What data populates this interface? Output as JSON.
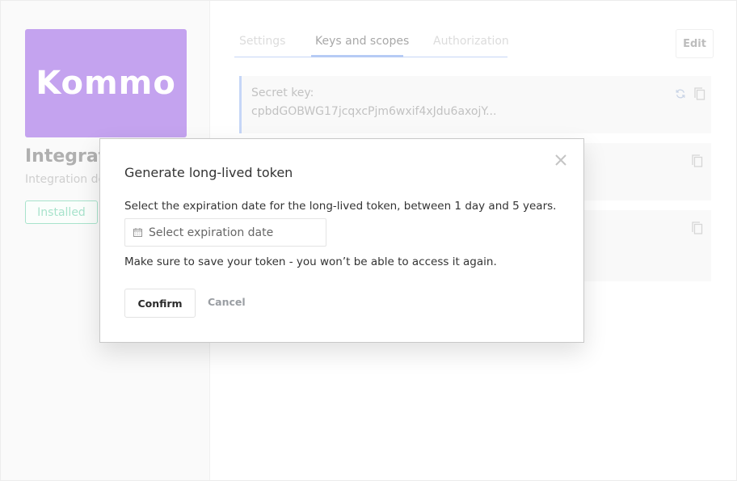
{
  "integration": {
    "logo_text": "Kommo",
    "title": "Integration",
    "description": "Integration description",
    "status_badge": "Installed",
    "brand_color": "#c4a3ef"
  },
  "tabs": [
    {
      "label": "Settings",
      "active": false
    },
    {
      "label": "Keys and scopes",
      "active": true
    },
    {
      "label": "Authorization",
      "active": false
    }
  ],
  "toolbar": {
    "edit_label": "Edit"
  },
  "keys": [
    {
      "label": "Secret key:",
      "value": "cpbdGOBWG17jcqxcPjm6wxif4xJdu6axojY...",
      "icons": [
        "refresh-icon",
        "copy-icon"
      ]
    },
    {
      "label": "",
      "value": "",
      "icons": [
        "copy-icon"
      ]
    },
    {
      "label": "",
      "value": "",
      "icons": [
        "copy-icon"
      ]
    }
  ],
  "modal": {
    "title": "Generate long-lived token",
    "description": "Select the expiration date for the long-lived token, between 1 day and 5 years.",
    "date_input": {
      "placeholder": "Select expiration date",
      "value": ""
    },
    "warning": "Make sure to save your token - you won’t be able to access it again.",
    "confirm_label": "Confirm",
    "cancel_label": "Cancel",
    "close_icon": "close-icon"
  }
}
